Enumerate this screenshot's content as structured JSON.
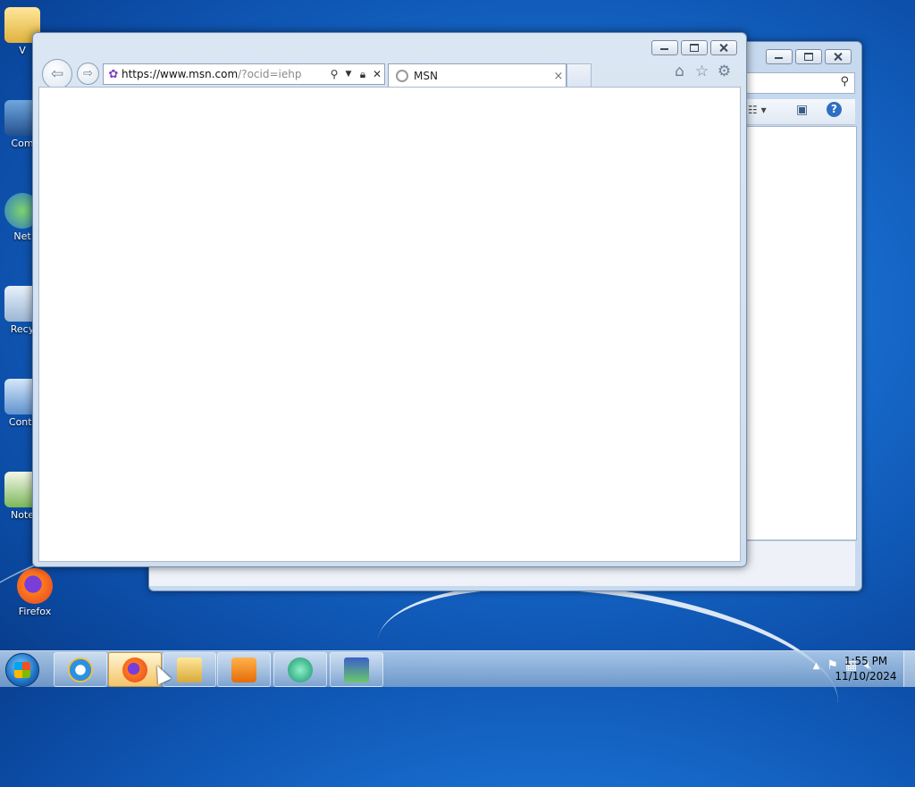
{
  "desktop": {
    "icons": [
      {
        "label": "V",
        "icon": "folder-icon"
      },
      {
        "label": "Com",
        "icon": "computer-icon"
      },
      {
        "label": "Net",
        "icon": "network-icon"
      },
      {
        "label": "Recy",
        "icon": "recycle-bin-icon"
      },
      {
        "label": "Contr",
        "icon": "control-panel-icon"
      },
      {
        "label": "Note",
        "icon": "notepad-icon"
      },
      {
        "label": "Firefox",
        "icon": "firefox-icon"
      }
    ]
  },
  "ie": {
    "url_prefix": "https://",
    "url_host": "www.msn.com",
    "url_rest": "/?ocid=iehp",
    "tab_title": "MSN",
    "tab_close": "×"
  },
  "taskbar": {
    "time": "1:55 PM",
    "date": "11/10/2024",
    "apps": [
      {
        "name": "internet-explorer",
        "active": false
      },
      {
        "name": "firefox",
        "active": true
      },
      {
        "name": "file-explorer",
        "active": false
      },
      {
        "name": "media-player",
        "active": false
      },
      {
        "name": "app-green",
        "active": false
      },
      {
        "name": "checklist-app",
        "active": false
      }
    ]
  },
  "colors": {
    "desktop_bg": "#1566c7",
    "window_frame": "#cfdded",
    "active_taskbar": "#f4c46a"
  }
}
